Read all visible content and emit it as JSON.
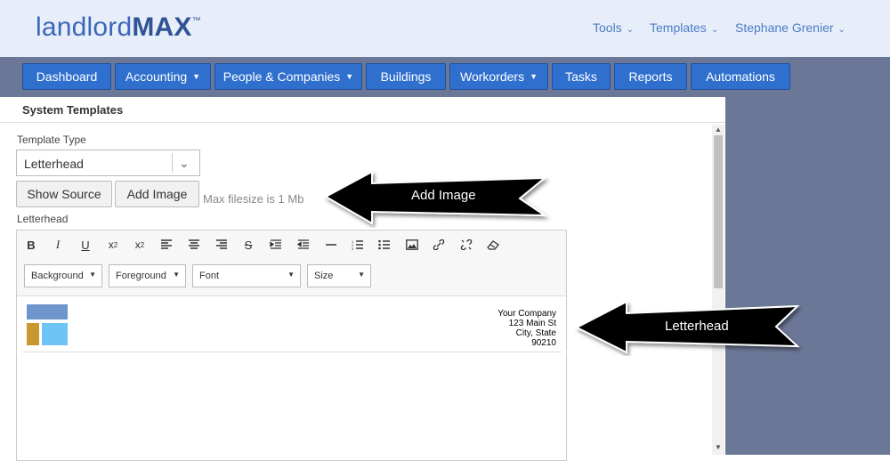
{
  "brand": {
    "part1": "landlord",
    "part2": "MAX",
    "tm": "™"
  },
  "topnav": [
    {
      "label": "Tools"
    },
    {
      "label": "Templates"
    },
    {
      "label": "Stephane Grenier"
    }
  ],
  "nav": [
    {
      "label": "Dashboard"
    },
    {
      "label": "Accounting"
    },
    {
      "label": "People & Companies"
    },
    {
      "label": "Buildings"
    },
    {
      "label": "Workorders"
    },
    {
      "label": "Tasks"
    },
    {
      "label": "Reports"
    },
    {
      "label": "Automations"
    }
  ],
  "page": {
    "title": "System Templates",
    "template_type_label": "Template Type",
    "template_type_value": "Letterhead",
    "show_source": "Show Source",
    "add_image": "Add Image",
    "max_filesize": "Max filesize is 1 Mb",
    "letterhead_label": "Letterhead"
  },
  "editor": {
    "dropdowns": [
      "Background",
      "Foreground",
      "Font",
      "Size"
    ],
    "letterhead": {
      "address": [
        "Your Company",
        "123 Main St",
        "City, State",
        "90210"
      ],
      "logo_colors": {
        "top": "#6f95cd",
        "left": "#c9962f",
        "right": "#6ec3f7"
      }
    }
  },
  "callouts": {
    "add_image": "Add Image",
    "letterhead": "Letterhead"
  },
  "colors": {
    "nav_button": "#2f6fcd",
    "nav_bar": "#6b7796",
    "header_bg": "#e8eef9"
  }
}
